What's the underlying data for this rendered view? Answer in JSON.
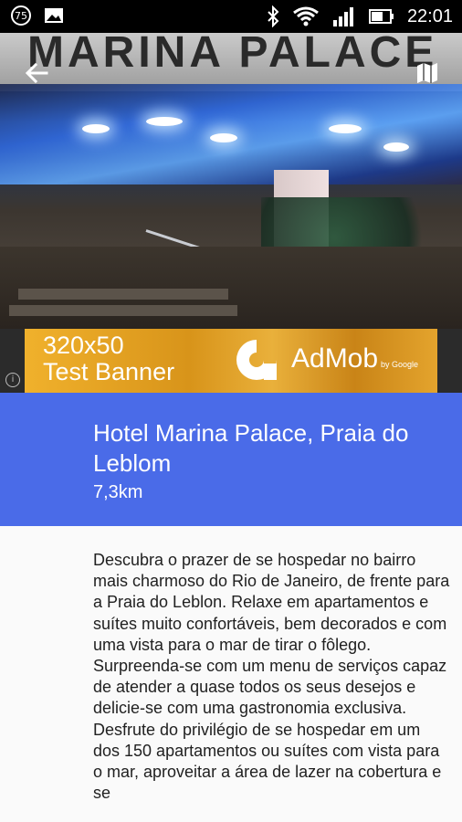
{
  "status_bar": {
    "notification_badge": "75",
    "time": "22:01",
    "icons": [
      "notification-badge-icon",
      "image-icon",
      "bluetooth-icon",
      "wifi-icon",
      "signal-icon",
      "battery-icon"
    ]
  },
  "hero": {
    "sign_text": "MARINA PALACE",
    "back_icon": "arrow-back-icon",
    "map_icon": "map-icon"
  },
  "ad_banner": {
    "line1": "320x50",
    "line2": "Test Banner",
    "brand": "AdMob",
    "by": "by Google",
    "info_icon": "i"
  },
  "hotel": {
    "name": "Hotel Marina Palace, Praia do Leblom",
    "distance": "7,3km",
    "description": "Descubra o prazer de se hospedar no bairro mais charmoso do Rio de Janeiro, de frente para a Praia do Leblon. Relaxe em apartamentos e suítes muito confortáveis, bem decorados e com uma vista para o mar de tirar o fôlego. Surpreenda-se com um menu de serviços capaz de atender a quase todos os seus desejos e delicie-se com uma gastronomia exclusiva. Desfrute do privilégio de se hospedar em um dos 150 apartamentos ou suítes com vista para o mar, aproveitar a área de lazer na cobertura e se"
  },
  "colors": {
    "header_blue": "#4a6be8",
    "ad_gold": "#e4a42d",
    "status_bar": "#000000"
  }
}
